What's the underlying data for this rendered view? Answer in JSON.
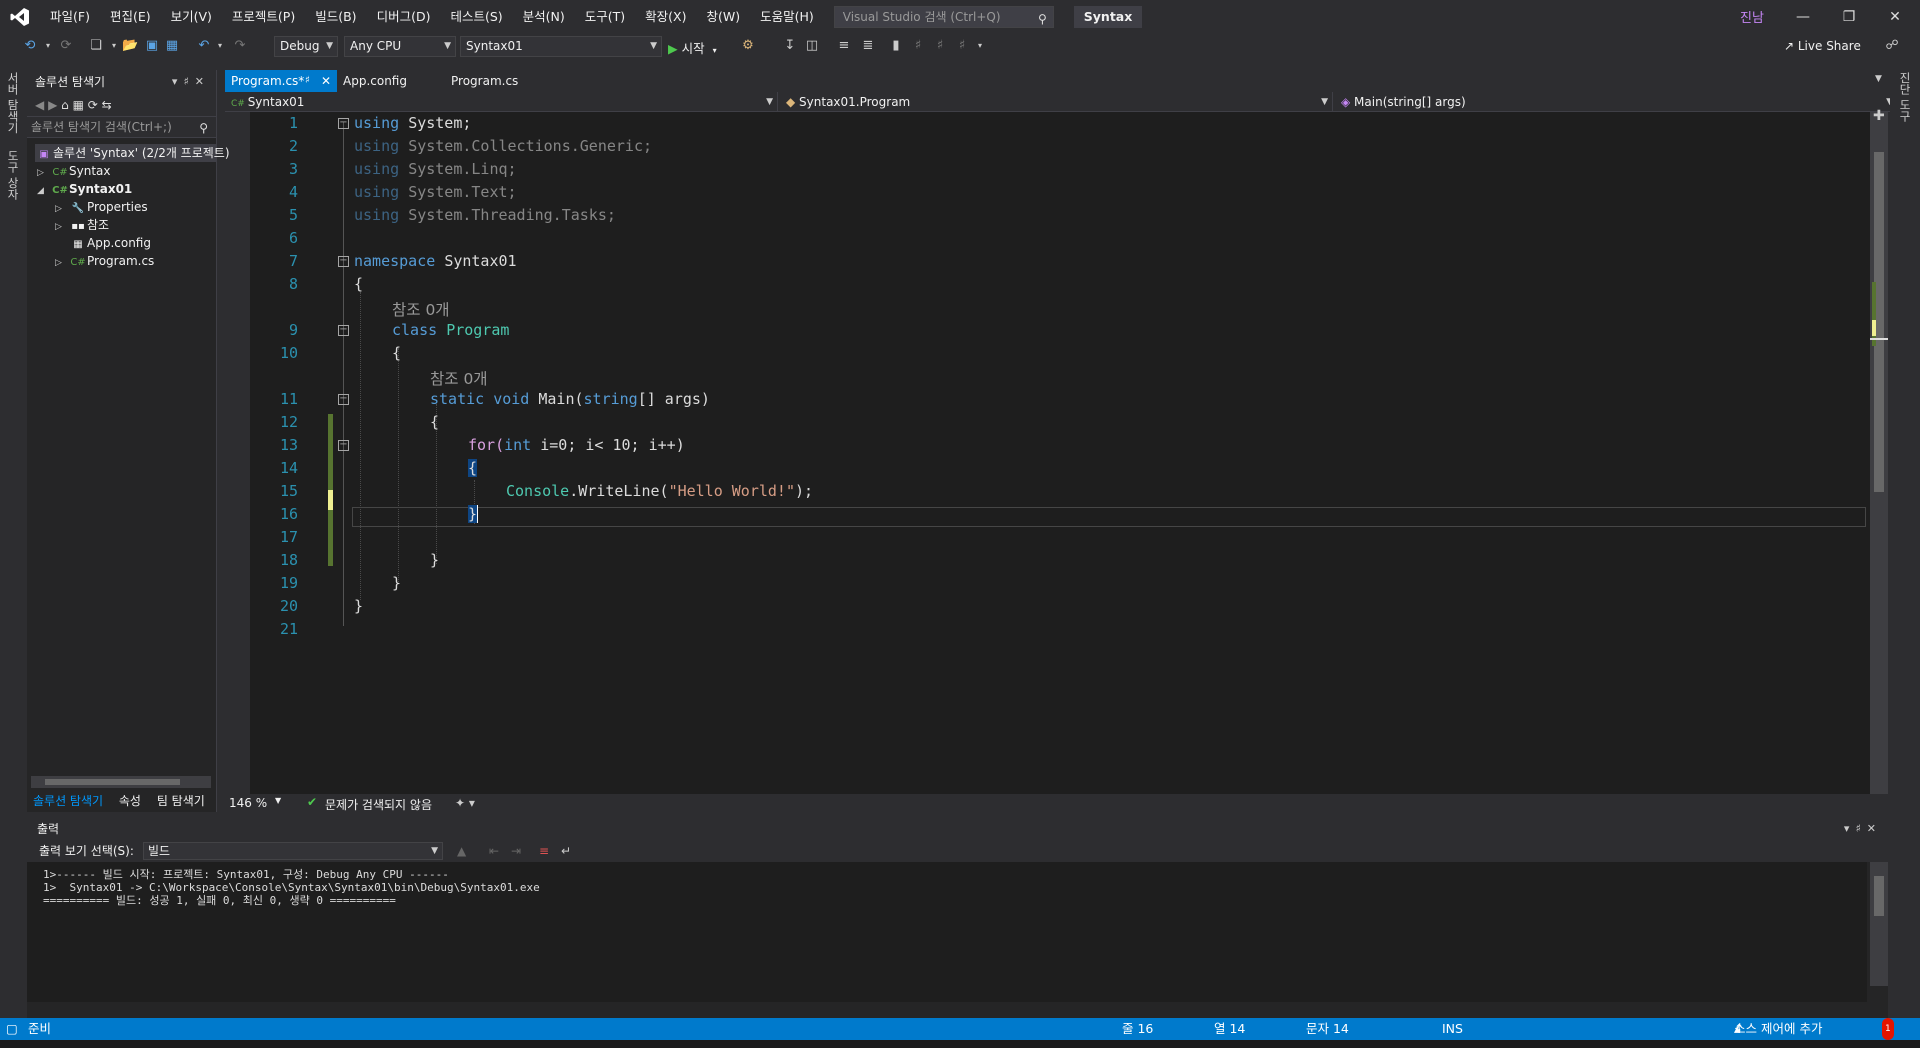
{
  "menu": {
    "items": [
      "파일(F)",
      "편집(E)",
      "보기(V)",
      "프로젝트(P)",
      "빌드(B)",
      "디버그(D)",
      "테스트(S)",
      "분석(N)",
      "도구(T)",
      "확장(X)",
      "창(W)",
      "도움말(H)"
    ],
    "search_placeholder": "Visual Studio 검색 (Ctrl+Q)",
    "solution_name": "Syntax",
    "user": "진남"
  },
  "toolbar": {
    "config": "Debug",
    "platform": "Any CPU",
    "startup_project": "Syntax01",
    "start_label": "시작",
    "liveshare_label": "Live Share"
  },
  "side_tabs": {
    "left": [
      "서버 탐색기",
      "도구 상자"
    ],
    "right": [
      "진단 도구"
    ]
  },
  "solution_explorer": {
    "title": "솔루션 탐색기",
    "search_placeholder": "솔루션 탐색기 검색(Ctrl+;)",
    "tree": [
      {
        "label": "솔루션 'Syntax' (2/2개 프로젝트)",
        "icon": "solution-icon"
      },
      {
        "label": "Syntax",
        "icon": "csharp-project-icon"
      },
      {
        "label": "Syntax01",
        "icon": "csharp-project-icon"
      },
      {
        "label": "Properties",
        "icon": "wrench-icon"
      },
      {
        "label": "참조",
        "icon": "references-icon"
      },
      {
        "label": "App.config",
        "icon": "config-file-icon"
      },
      {
        "label": "Program.cs",
        "icon": "csharp-file-icon"
      }
    ],
    "bottom_tabs": [
      "솔루션 탐색기",
      "속성",
      "팀 탐색기"
    ]
  },
  "editor": {
    "tabs": [
      "Program.cs*",
      "App.config",
      "Program.cs"
    ],
    "nav": {
      "project": "Syntax01",
      "type": "Syntax01.Program",
      "member": "Main(string[] args)"
    },
    "line_numbers": [
      "1",
      "2",
      "3",
      "4",
      "5",
      "6",
      "7",
      "8",
      "9",
      "10",
      "11",
      "12",
      "13",
      "14",
      "15",
      "16",
      "17",
      "18",
      "19",
      "20",
      "21"
    ],
    "codelens": "참조 0개",
    "code": {
      "using_kw": "using",
      "ns_system": "System;",
      "ns_generic": "System.Collections.Generic;",
      "ns_linq": "System.Linq;",
      "ns_text": "System.Text;",
      "ns_tasks": "System.Threading.Tasks;",
      "namespace_kw": "namespace",
      "namespace_name": "Syntax01",
      "open_brace": "{",
      "close_brace": "}",
      "class_kw": "class",
      "class_name": "Program",
      "static_kw": "static",
      "void_kw": "void",
      "main_name": "Main(",
      "string_kw": "string",
      "args_part": "[] args)",
      "for_kw": "for(",
      "int_kw": "int",
      "for_rest": " i=0; i< 10; i++)",
      "console_type": "Console",
      "writeline": ".WriteLine(",
      "hello_str": "\"Hello World!\"",
      "stmt_end": ");"
    },
    "zoom": "146 %",
    "issues": "문제가 검색되지 않음"
  },
  "output": {
    "title": "출력",
    "select_label": "출력 보기 선택(S):",
    "select_value": "빌드",
    "lines": [
      "1>------ 빌드 시작: 프로젝트: Syntax01, 구성: Debug Any CPU ------",
      "1>  Syntax01 -> C:\\Workspace\\Console\\Syntax\\Syntax01\\bin\\Debug\\Syntax01.exe",
      "========== 빌드: 성공 1, 실패 0, 최신 0, 생략 0 =========="
    ]
  },
  "statusbar": {
    "ready": "준비",
    "line": "줄 16",
    "col": "열 14",
    "ch": "문자 14",
    "mode": "INS",
    "source_control": "소스 제어에 추가",
    "notifications": "1"
  }
}
